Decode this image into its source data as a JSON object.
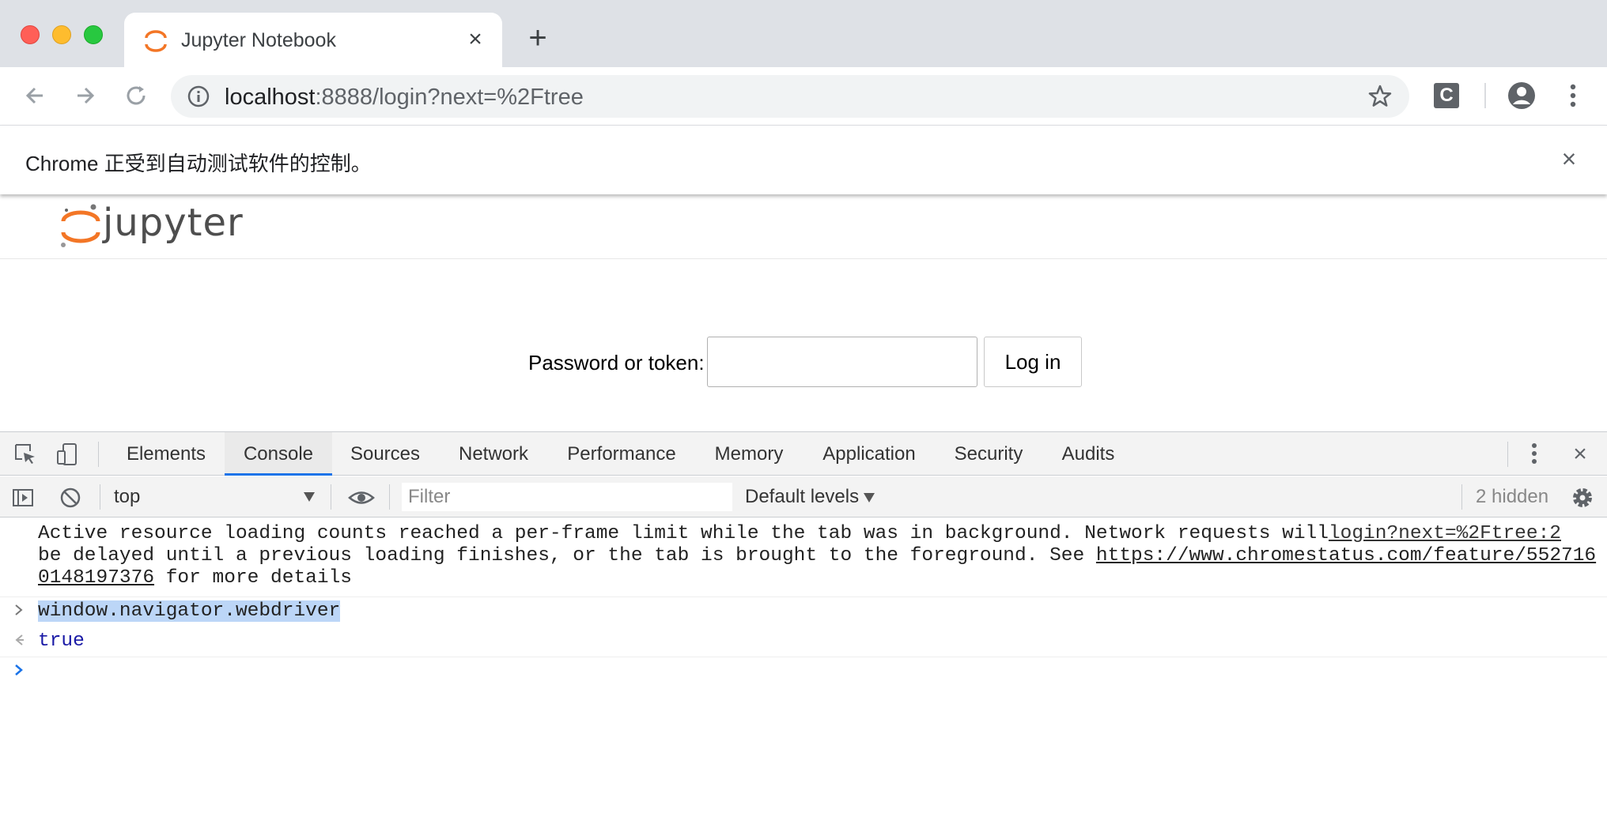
{
  "browser": {
    "tab_title": "Jupyter Notebook",
    "tab_close_icon": "×",
    "newtab_icon": "+",
    "url_host": "localhost",
    "url_rest": ":8888/login?next=%2Ftree",
    "ext_letter": "C"
  },
  "infobar": {
    "text": "Chrome 正受到自动测试软件的控制。",
    "close_icon": "×"
  },
  "page": {
    "wordmark": "jupyter",
    "password_label": "Password or token:",
    "password_value": "",
    "login_button": "Log in"
  },
  "devtools": {
    "tabs": [
      "Elements",
      "Console",
      "Sources",
      "Network",
      "Performance",
      "Memory",
      "Application",
      "Security",
      "Audits"
    ],
    "active_tab": "Console",
    "close_icon": "×",
    "context": "top",
    "filter_placeholder": "Filter",
    "levels": "Default levels",
    "hidden_count": "2 hidden",
    "messages": {
      "warning": {
        "line1": "Active resource loading counts reached a per-frame limit while the tab was in background. Network requests will",
        "line2_pre": "be delayed until a previous loading finishes, or the tab is brought to the foreground. See ",
        "line2_link": "https://www.chromestatus.com/feature/552716",
        "line3_link": "0148197376",
        "line3_post": " for more details",
        "source": "login?next=%2Ftree:2"
      },
      "input": "window.navigator.webdriver",
      "output": "true"
    }
  },
  "colors": {
    "accent": "#1a73e8",
    "jupyter_orange": "#f37626",
    "highlight": "#bcd6f7"
  }
}
